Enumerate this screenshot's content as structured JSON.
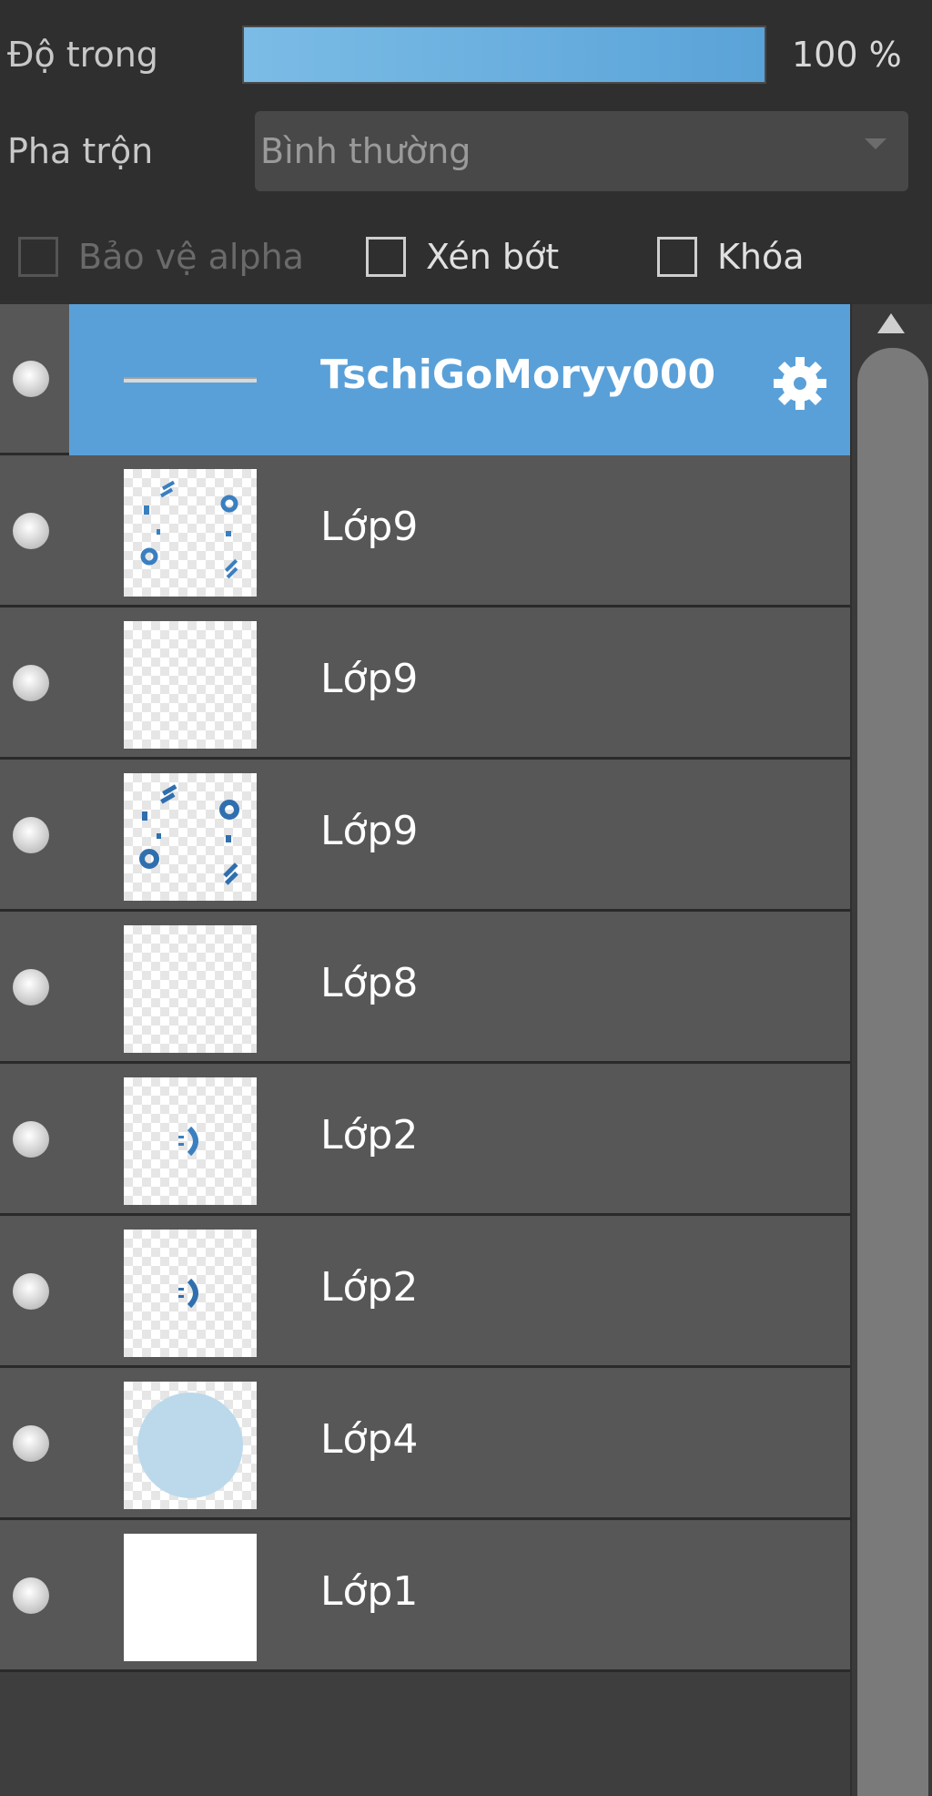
{
  "opacity": {
    "label": "Độ trong",
    "value_text": "100 %",
    "value": 100
  },
  "blend": {
    "label": "Pha trộn",
    "selected": "Bình thường"
  },
  "checks": {
    "alpha": {
      "label": "Bảo vệ alpha",
      "checked": false,
      "enabled": false
    },
    "clip": {
      "label": "Xén bớt",
      "checked": false,
      "enabled": true
    },
    "lock": {
      "label": "Khóa",
      "checked": false,
      "enabled": true
    }
  },
  "layers": [
    {
      "name": "TschiGoMoryy000",
      "selected": true,
      "thumb": "text-strike"
    },
    {
      "name": "Lớp9",
      "selected": false,
      "thumb": "circle-text"
    },
    {
      "name": "Lớp9",
      "selected": false,
      "thumb": "transparent"
    },
    {
      "name": "Lớp9",
      "selected": false,
      "thumb": "circle-text"
    },
    {
      "name": "Lớp8",
      "selected": false,
      "thumb": "transparent"
    },
    {
      "name": "Lớp2",
      "selected": false,
      "thumb": "small-mark"
    },
    {
      "name": "Lớp2",
      "selected": false,
      "thumb": "small-mark"
    },
    {
      "name": "Lớp4",
      "selected": false,
      "thumb": "blue-circle"
    },
    {
      "name": "Lớp1",
      "selected": false,
      "thumb": "white"
    }
  ],
  "colors": {
    "selection": "#5aa0d8",
    "slider": "#6ab0e0",
    "panel_bg": "#2f2f2f",
    "row_bg": "#575757",
    "thumb_mark": "#3a7fc0"
  }
}
